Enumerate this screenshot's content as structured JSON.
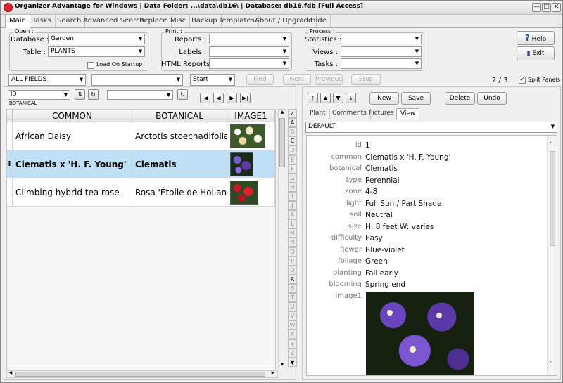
{
  "window": {
    "title": "Organizer Advantage for Windows | Data Folder: ...\\data\\db16\\ | Database: db16.fdb [Full Access]",
    "minimize": "—",
    "restore": "□",
    "close": "✕"
  },
  "menu_tabs": [
    "Main",
    "Tasks",
    "Search",
    "Advanced Search",
    "Replace",
    "Misc",
    "Backup",
    "Templates",
    "About / Upgrade",
    "Hide"
  ],
  "open_group": {
    "title": "Open :",
    "database_label": "Database :",
    "database_value": "Garden",
    "table_label": "Table :",
    "table_value": "PLANTS",
    "load_on_startup": "Load On Startup"
  },
  "print_group": {
    "title": "Print :",
    "reports_label": "Reports :",
    "labels_label": "Labels :",
    "html_reports_label": "HTML Reports :"
  },
  "process_group": {
    "title": "Process :",
    "statistics_label": "Statistics :",
    "views_label": "Views :",
    "tasks_label": "Tasks :"
  },
  "help_button": "Help",
  "exit_button": "Exit",
  "search_bar": {
    "field": "ALL FIELDS",
    "mode": "Start",
    "find": "Find",
    "next": "Next",
    "previous": "Previous",
    "stop": "Stop",
    "record_counter": "2 / 3",
    "split_panels": "Split Panels",
    "split_checked": "✓"
  },
  "sort_bar": {
    "sort_field": "ID",
    "sort_sub": "BOTANICAL"
  },
  "grid": {
    "columns": [
      "COMMON",
      "BOTANICAL",
      "IMAGE1"
    ],
    "rows": [
      {
        "common": "African Daisy",
        "botanical": "Arctotis stoechadifolia",
        "marker": ""
      },
      {
        "common": "Clematis x 'H. F. Young'",
        "botanical": "Clematis",
        "marker": "I"
      },
      {
        "common": "Climbing hybrid tea rose",
        "botanical": "Rosa 'Étoile de Hollande'",
        "marker": ""
      }
    ]
  },
  "alpha_index": [
    "✓",
    "A",
    "B",
    "C",
    "D",
    "E",
    "F",
    "G",
    "H",
    "I",
    "J",
    "K",
    "L",
    "M",
    "N",
    "O",
    "P",
    "Q",
    "R",
    "S",
    "T",
    "U",
    "V",
    "W",
    "X",
    "Y",
    "Z"
  ],
  "alpha_active": [
    "✓",
    "A",
    "C",
    "R"
  ],
  "record_buttons": {
    "new": "New",
    "save": "Save",
    "delete": "Delete",
    "undo": "Undo"
  },
  "right_tabs": [
    "Plant",
    "Comments",
    "Pictures",
    "View"
  ],
  "view_template": "DEFAULT",
  "record": [
    {
      "label": "id",
      "value": "1"
    },
    {
      "label": "common",
      "value": "Clematis x 'H. F. Young'"
    },
    {
      "label": "botanical",
      "value": "Clematis"
    },
    {
      "label": "type",
      "value": "Perennial"
    },
    {
      "label": "zone",
      "value": "4-8"
    },
    {
      "label": "light",
      "value": "Full Sun / Part Shade"
    },
    {
      "label": "soil",
      "value": "Neutral"
    },
    {
      "label": "size",
      "value": "H: 8 feet W: varies"
    },
    {
      "label": "difficulty",
      "value": "Easy"
    },
    {
      "label": "flower",
      "value": "Blue-violet"
    },
    {
      "label": "foliage",
      "value": "Green"
    },
    {
      "label": "planting",
      "value": "Fall early"
    },
    {
      "label": "blooming",
      "value": "Spring end"
    },
    {
      "label": "image1",
      "value": ""
    }
  ],
  "colors": {
    "selected_row": "#bfe0f7",
    "flower_purple": "#5b3aa8",
    "title_logo": "#d22233"
  }
}
